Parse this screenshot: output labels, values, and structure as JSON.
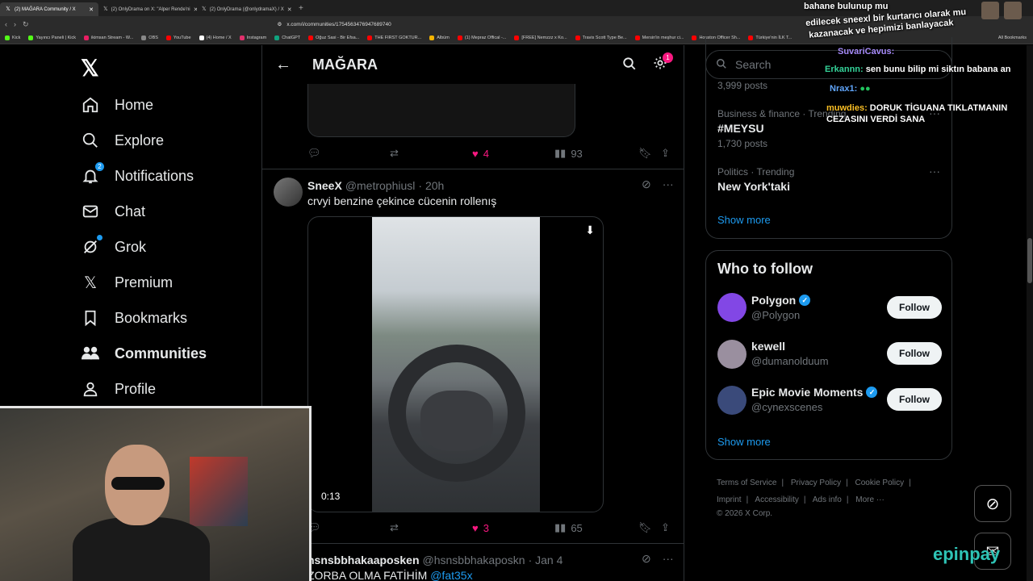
{
  "browser": {
    "tabs": [
      {
        "title": "(2) MAĞARA Community / X",
        "active": true
      },
      {
        "title": "(2) OnlyDrama on X: \"Alper Rende'ni",
        "active": false
      },
      {
        "title": "(2) OnlyDrama (@onlydramaX) / X",
        "active": false
      }
    ],
    "url": "x.com/i/communities/1754563476947689740",
    "bookmarks": [
      "Kick",
      "Yayıncı Paneli | Kick",
      "ikimsan Stream - W...",
      "OBS",
      "YouTube",
      "(4) Home / X",
      "Instagram",
      "ChatGPT",
      "Oğuz Sasi - Bir Efsa...",
      "THE FIRST GOKTUR...",
      "Albüm",
      "(1) Mepraz Offical -...",
      "[FREE] Nemzzz x Ko...",
      "Travis Scott Type Be...",
      "Mersin'in meşhur ci...",
      "Houston Officer Sh...",
      "Türkiye'nin İLK T..."
    ],
    "all_bookmarks": "All Bookmarks"
  },
  "nav": {
    "items": [
      {
        "label": "Home",
        "icon": "home-icon"
      },
      {
        "label": "Explore",
        "icon": "search-icon"
      },
      {
        "label": "Notifications",
        "icon": "bell-icon",
        "badge": "2"
      },
      {
        "label": "Chat",
        "icon": "mail-icon"
      },
      {
        "label": "Grok",
        "icon": "grok-icon"
      },
      {
        "label": "Premium",
        "icon": "x-premium-icon"
      },
      {
        "label": "Bookmarks",
        "icon": "bookmark-icon"
      },
      {
        "label": "Communities",
        "icon": "people-icon"
      },
      {
        "label": "Profile",
        "icon": "person-icon"
      }
    ]
  },
  "header": {
    "title": "MAĞARA",
    "settings_badge": "1"
  },
  "prev_tweet": {
    "likes": "4",
    "views": "93"
  },
  "tweet1": {
    "name": "SneeX",
    "handle": "@metrophiusl",
    "time": "· 20h",
    "text": "crvyi benzine çekince cücenin rollenış",
    "video_time": "0:13",
    "likes": "3",
    "views": "65"
  },
  "tweet2": {
    "name": "hsnsbbhakaaposken",
    "handle": "@hsnsbbhakaposkn",
    "time": "· Jan 4",
    "text_prefix": "ZORBA OLMA FATİHİM ",
    "mention": "@fat35x"
  },
  "right": {
    "search_placeholder": "Search",
    "trends": [
      {
        "meta": "",
        "title": "",
        "posts": "3,999 posts"
      },
      {
        "meta": "Business & finance · Trending",
        "title": "#MEYSU",
        "posts": "1,730 posts"
      },
      {
        "meta": "Politics · Trending",
        "title": "New York'taki",
        "posts": ""
      }
    ],
    "show_more": "Show more",
    "wtf_title": "Who to follow",
    "follow": [
      {
        "name": "Polygon",
        "handle": "@Polygon",
        "verified": true,
        "color": "#8247e5"
      },
      {
        "name": "kewell",
        "handle": "@dumanolduum",
        "verified": false,
        "color": "#9a8f9f"
      },
      {
        "name": "Epic Movie Moments",
        "handle": "@cynexscenes",
        "verified": true,
        "color": "#3a4a7a"
      }
    ],
    "follow_label": "Follow",
    "footer": {
      "links1": [
        "Terms of Service",
        "Privacy Policy",
        "Cookie Policy"
      ],
      "links2": [
        "Imprint",
        "Accessibility",
        "Ads info",
        "More ···"
      ],
      "copyright": "© 2026 X Corp."
    }
  },
  "chat_overlay": {
    "line1": "bahane bulunup mu",
    "line2": "edilecek sneexl bir kurtarıcı olarak mu",
    "line3": "kazanacak ve hepimizi banlayacak",
    "user1": "SuvariCavus:",
    "user2": "Erkannn:",
    "msg2": "sen bunu bilip mi siktın babana an",
    "user3": "Nrax1:",
    "user4": "muwdies:",
    "msg4a": "DORUK TİGUANA TIKLATMANIN",
    "msg4b": "CEZASINI VERDİ SANA"
  },
  "epin": "epinpay"
}
